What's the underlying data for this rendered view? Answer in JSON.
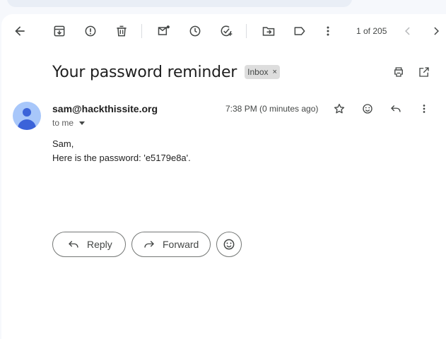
{
  "toolbar": {
    "icons": [
      "back-arrow-icon",
      "archive-icon",
      "report-spam-icon",
      "delete-icon",
      "mark-unread-icon",
      "snooze-icon",
      "add-to-tasks-icon",
      "move-to-icon",
      "label-icon",
      "more-vert-icon"
    ],
    "pager_text": "1 of 205",
    "nav_icons": [
      "newer-chevron-icon",
      "older-chevron-icon"
    ]
  },
  "email": {
    "subject": "Your password reminder",
    "label": "Inbox",
    "label_remove": "×",
    "sender": "sam@hackthissite.org",
    "recipient": "to me",
    "timestamp": "7:38 PM (0 minutes ago)",
    "body_lines": [
      "Sam,",
      "Here is the password: 'e5179e8a'."
    ]
  },
  "actions": {
    "reply_label": "Reply",
    "forward_label": "Forward"
  },
  "colors": {
    "background": "#f6f8fc",
    "card": "#ffffff",
    "avatar_bg": "#a8c7fa",
    "avatar_fg": "#3b63d9",
    "badge_bg": "#dddddd",
    "icon": "#444746"
  }
}
